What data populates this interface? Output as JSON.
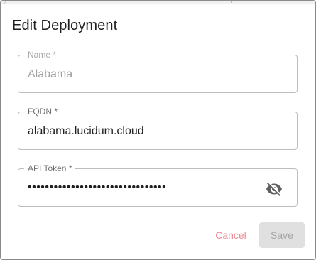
{
  "dialog": {
    "title": "Edit Deployment"
  },
  "fields": {
    "name": {
      "label": "Name *",
      "value": "Alabama"
    },
    "fqdn": {
      "label": "FQDN *",
      "value": "alabama.lucidum.cloud"
    },
    "api_token": {
      "label": "API Token *",
      "masked_value": "••••••••••••••••••••••••••••••••",
      "visibility_icon": "eye-off-icon"
    }
  },
  "actions": {
    "cancel_label": "Cancel",
    "save_label": "Save"
  },
  "colors": {
    "cancel_text": "#ef8b95",
    "save_disabled_bg": "#e0e0e0",
    "save_disabled_text": "#a6a6a6",
    "field_border": "#bdbdbd"
  }
}
